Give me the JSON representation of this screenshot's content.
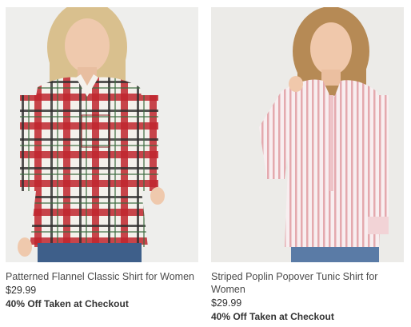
{
  "products": [
    {
      "title": "Patterned Flannel Classic Shirt for Women",
      "price": "$29.99",
      "promo": "40% Off Taken at Checkout",
      "image_icon": "flannel-shirt-product-image"
    },
    {
      "title": "Striped Poplin Popover Tunic Shirt for Women",
      "price": "$29.99",
      "promo": "40% Off Taken at Checkout",
      "image_icon": "striped-tunic-product-image"
    }
  ],
  "colors": {
    "background": "#ffffff",
    "photo_background": "#eeeeec",
    "text": "#4a4a4a",
    "flannel_red": "#c0262e",
    "flannel_white": "#f4f1ec",
    "stripe_pink": "#e4a9ae"
  }
}
